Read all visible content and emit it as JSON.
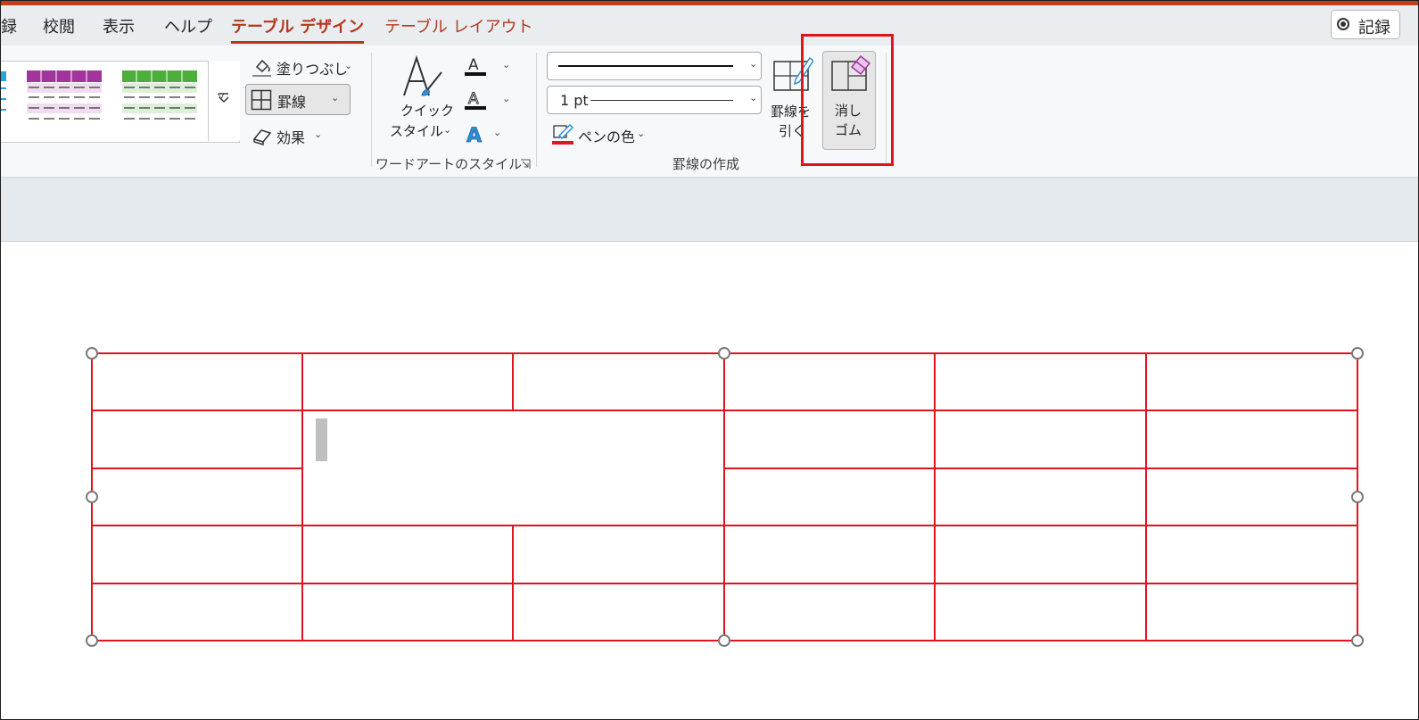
{
  "tabs": [
    {
      "label": "録",
      "state": "normal"
    },
    {
      "label": "校閲",
      "state": "normal"
    },
    {
      "label": "表示",
      "state": "normal"
    },
    {
      "label": "ヘルプ",
      "state": "normal"
    },
    {
      "label": "テーブル デザイン",
      "state": "active"
    },
    {
      "label": "テーブル レイアウト",
      "state": "accent"
    }
  ],
  "record_button": {
    "label": "記録",
    "icon": "record-icon"
  },
  "table_styles": {
    "thumb_colors": [
      "#29a3d9",
      "#a3349d",
      "#4caf39"
    ],
    "more_icon": "gallery-more-icon"
  },
  "shading": {
    "label": "塗りつぶし",
    "icon": "paint-bucket-icon"
  },
  "borders": {
    "label": "罫線",
    "icon": "borders-grid-icon"
  },
  "effects": {
    "label": "効果",
    "icon": "effects-eraser-shape-icon"
  },
  "wordart": {
    "quick_styles_line1": "クイック",
    "quick_styles_line2": "スタイル",
    "group_label": "ワードアートのスタイル",
    "text_fill_icon": "text-fill-icon",
    "text_outline_icon": "text-outline-icon",
    "text_effects_icon": "text-effects-icon",
    "launcher_icon": "dialog-launcher-icon"
  },
  "draw_borders": {
    "pen_weight_value": "1 pt",
    "pen_color_label": "ペンの色",
    "pen_color": "#e0141e",
    "draw_table_line1": "罫線を",
    "draw_table_line2": "引く",
    "eraser_line1": "消し",
    "eraser_line2": "ゴム",
    "group_label": "罫線の作成"
  },
  "table": {
    "border_color": "#e0141e",
    "cell_text": ""
  }
}
